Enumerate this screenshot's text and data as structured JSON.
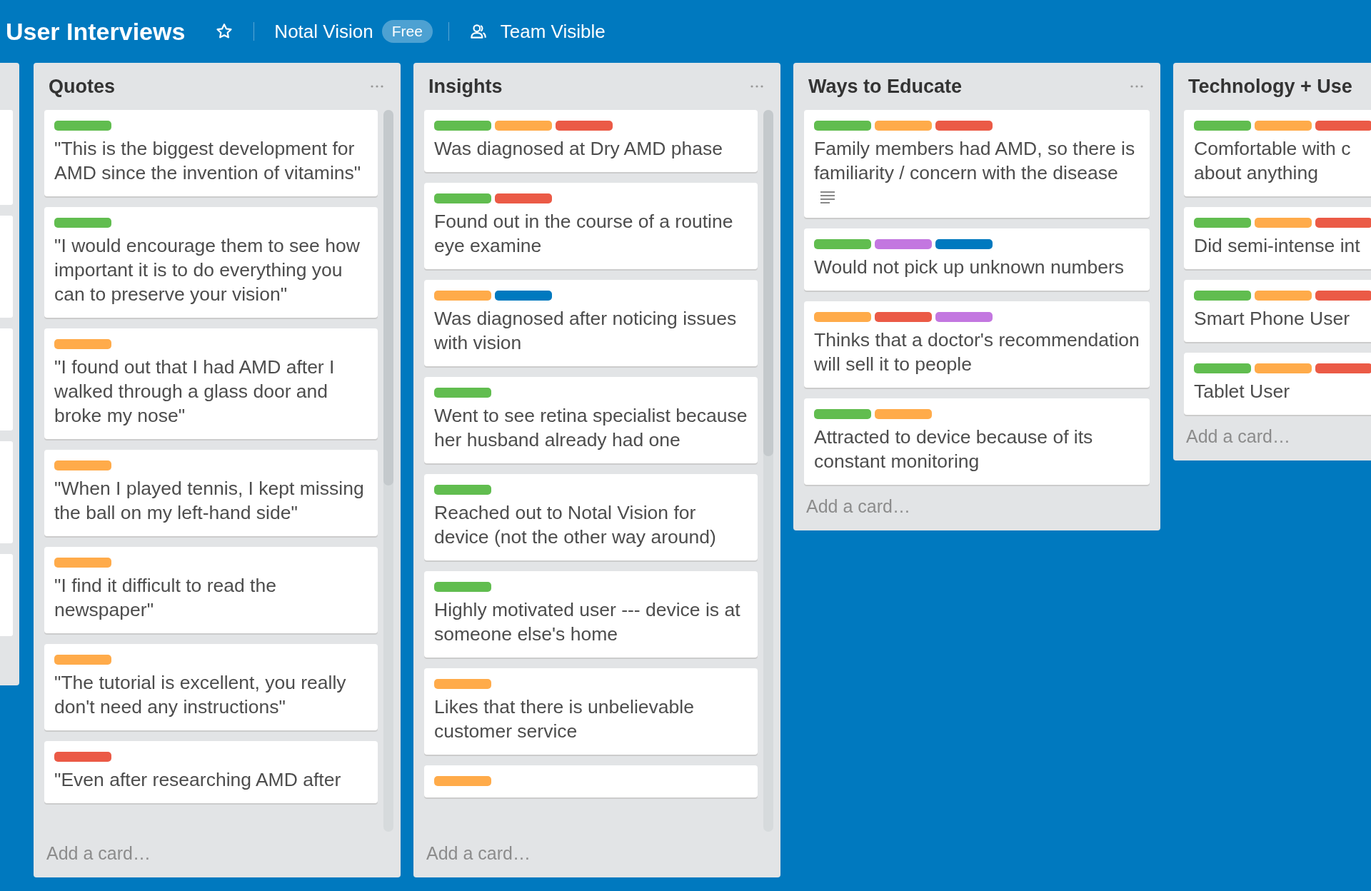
{
  "board": {
    "title": "User Interviews",
    "team": "Notal Vision",
    "team_badge": "Free",
    "visibility": "Team Visible"
  },
  "lists": [
    {
      "title": "Quotes",
      "menu": true,
      "add_card": "Add a card…",
      "cards": [
        {
          "labels": [
            {
              "color": "#61bd4f"
            }
          ],
          "text": "\"This is the biggest development for AMD since the invention of vitamins\""
        },
        {
          "labels": [
            {
              "color": "#61bd4f"
            }
          ],
          "text": "\"I would encourage them to see how important it is to do everything you can to preserve your vision\""
        },
        {
          "labels": [
            {
              "color": "#ffab4a"
            }
          ],
          "text": "\"I found out that I had AMD after I walked through a glass door and broke my nose\""
        },
        {
          "labels": [
            {
              "color": "#ffab4a"
            }
          ],
          "text": "\"When I played tennis, I kept missing the ball on my left-hand side\""
        },
        {
          "labels": [
            {
              "color": "#ffab4a"
            }
          ],
          "text": "\"I find it difficult to read the newspaper\""
        },
        {
          "labels": [
            {
              "color": "#ffab4a"
            }
          ],
          "text": "\"The tutorial is excellent, you really don't need any instructions\""
        },
        {
          "labels": [
            {
              "color": "#eb5a46"
            }
          ],
          "text": "\"Even after researching AMD after"
        }
      ]
    },
    {
      "title": "Insights",
      "menu": true,
      "add_card": "Add a card…",
      "cards": [
        {
          "labels": [
            {
              "color": "#61bd4f"
            },
            {
              "color": "#ffab4a"
            },
            {
              "color": "#eb5a46"
            }
          ],
          "text": "Was diagnosed at Dry AMD phase"
        },
        {
          "labels": [
            {
              "color": "#61bd4f"
            },
            {
              "color": "#eb5a46"
            }
          ],
          "text": "Found out in the course of a routine eye examine"
        },
        {
          "labels": [
            {
              "color": "#ffab4a"
            },
            {
              "color": "#0079bf"
            }
          ],
          "text": "Was diagnosed after noticing issues with vision"
        },
        {
          "labels": [
            {
              "color": "#61bd4f"
            }
          ],
          "text": "Went to see retina specialist because her husband already had one"
        },
        {
          "labels": [
            {
              "color": "#61bd4f"
            }
          ],
          "text": "Reached out to Notal Vision for device (not the other way around)"
        },
        {
          "labels": [
            {
              "color": "#61bd4f"
            }
          ],
          "text": "Highly motivated user --- device is at someone else's home"
        },
        {
          "labels": [
            {
              "color": "#ffab4a"
            }
          ],
          "text": "Likes that there is unbelievable customer service"
        },
        {
          "labels": [
            {
              "color": "#ffab4a"
            }
          ]
        }
      ]
    },
    {
      "title": "Ways to Educate",
      "menu": true,
      "add_card": "Add a card…",
      "cards": [
        {
          "labels": [
            {
              "color": "#61bd4f"
            },
            {
              "color": "#ffab4a"
            },
            {
              "color": "#eb5a46"
            }
          ],
          "text": "Family members had AMD, so there is familiarity / concern with the disease",
          "description": true
        },
        {
          "labels": [
            {
              "color": "#61bd4f"
            },
            {
              "color": "#c377e0"
            },
            {
              "color": "#0079bf"
            }
          ],
          "text": "Would not pick up unknown numbers"
        },
        {
          "labels": [
            {
              "color": "#ffab4a"
            },
            {
              "color": "#eb5a46"
            },
            {
              "color": "#c377e0"
            }
          ],
          "text": "Thinks that a doctor's recommendation will sell it to people"
        },
        {
          "labels": [
            {
              "color": "#61bd4f"
            },
            {
              "color": "#ffab4a"
            }
          ],
          "text": "Attracted to device because of its constant monitoring"
        }
      ]
    },
    {
      "title": "Technology + Use",
      "menu": false,
      "add_card": "Add a card…",
      "cards": [
        {
          "labels": [
            {
              "color": "#61bd4f"
            },
            {
              "color": "#ffab4a"
            },
            {
              "color": "#eb5a46"
            }
          ],
          "text": "Comfortable with c\nabout anything"
        },
        {
          "labels": [
            {
              "color": "#61bd4f"
            },
            {
              "color": "#ffab4a"
            },
            {
              "color": "#eb5a46"
            }
          ],
          "text": "Did semi-intense int"
        },
        {
          "labels": [
            {
              "color": "#61bd4f"
            },
            {
              "color": "#ffab4a"
            },
            {
              "color": "#eb5a46"
            }
          ],
          "text": "Smart Phone User"
        },
        {
          "labels": [
            {
              "color": "#61bd4f"
            },
            {
              "color": "#ffab4a"
            },
            {
              "color": "#eb5a46"
            }
          ],
          "text": "Tablet User"
        }
      ]
    }
  ]
}
